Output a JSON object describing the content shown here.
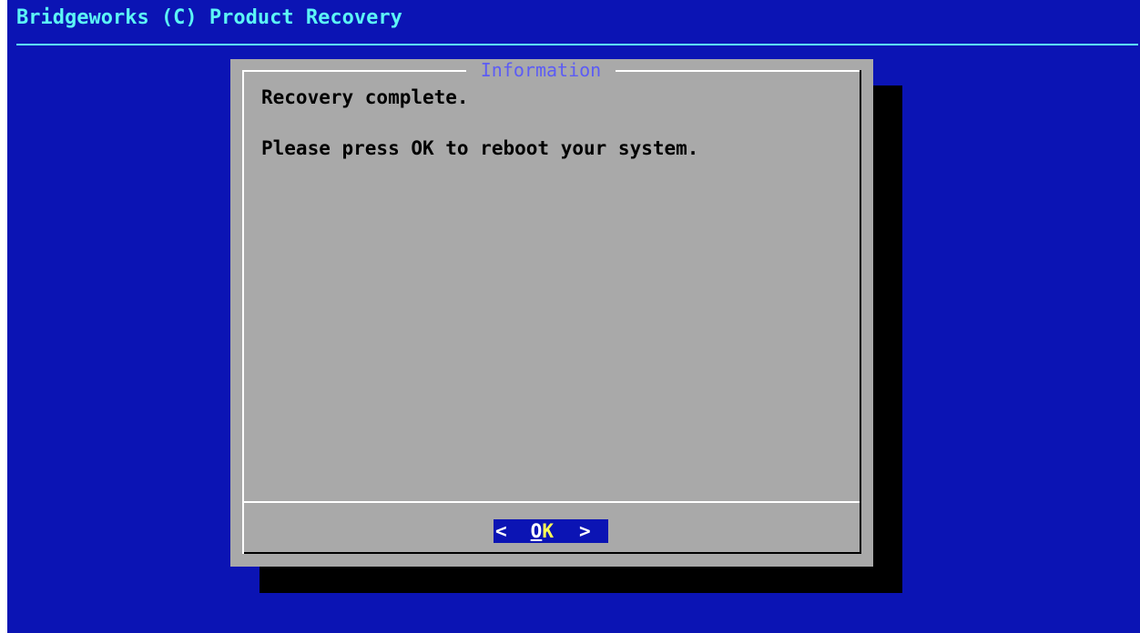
{
  "backtitle": "Bridgeworks (C) Product Recovery",
  "dialog": {
    "title": "Information",
    "message_line_1": "Recovery complete.",
    "message_line_2": "Please press OK to reboot your system.",
    "ok_button": {
      "left_bracket": "<",
      "hotkey": "O",
      "label_rest": "K",
      "right_bracket": ">"
    }
  },
  "colors": {
    "background": "#0b14b4",
    "backtitle": "#5cf5f5",
    "dialog_bg": "#a9a9a9",
    "dialog_title": "#5c5cf5",
    "button_bg": "#0b14b4",
    "button_hotkey": "#ffffff",
    "button_text": "#ffff55"
  }
}
